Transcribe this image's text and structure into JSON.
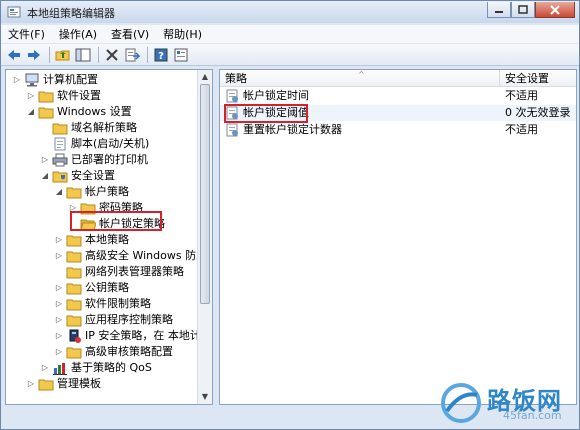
{
  "window": {
    "title": "本地组策略编辑器"
  },
  "menu": [
    {
      "label": "文件(F)"
    },
    {
      "label": "操作(A)"
    },
    {
      "label": "查看(V)"
    },
    {
      "label": "帮助(H)"
    }
  ],
  "toolbar": [
    "back-arrow-icon",
    "forward-arrow-icon",
    "up-folder-icon",
    "show-tree-icon",
    "delete-icon",
    "export-list-icon",
    "help-icon",
    "properties-icon"
  ],
  "tree": [
    {
      "label": "计算机配置",
      "depth": 0,
      "toggle": "collapsed",
      "icon": "computer"
    },
    {
      "label": "软件设置",
      "depth": 1,
      "toggle": "collapsed",
      "icon": "folder"
    },
    {
      "label": "Windows 设置",
      "depth": 1,
      "toggle": "expanded",
      "icon": "folder"
    },
    {
      "label": "域名解析策略",
      "depth": 2,
      "toggle": "none",
      "icon": "folder"
    },
    {
      "label": "脚本(启动/关机)",
      "depth": 2,
      "toggle": "none",
      "icon": "script"
    },
    {
      "label": "已部署的打印机",
      "depth": 2,
      "toggle": "collapsed",
      "icon": "printer"
    },
    {
      "label": "安全设置",
      "depth": 2,
      "toggle": "expanded",
      "icon": "security"
    },
    {
      "label": "帐户策略",
      "depth": 3,
      "toggle": "expanded",
      "icon": "folder"
    },
    {
      "label": "密码策略",
      "depth": 4,
      "toggle": "collapsed",
      "icon": "folder"
    },
    {
      "label": "帐户锁定策略",
      "depth": 4,
      "toggle": "none",
      "icon": "folder-open",
      "selected": true
    },
    {
      "label": "本地策略",
      "depth": 3,
      "toggle": "collapsed",
      "icon": "folder"
    },
    {
      "label": "高级安全 Windows 防火墙",
      "depth": 3,
      "toggle": "collapsed",
      "icon": "folder"
    },
    {
      "label": "网络列表管理器策略",
      "depth": 3,
      "toggle": "none",
      "icon": "folder"
    },
    {
      "label": "公钥策略",
      "depth": 3,
      "toggle": "collapsed",
      "icon": "folder"
    },
    {
      "label": "软件限制策略",
      "depth": 3,
      "toggle": "collapsed",
      "icon": "folder"
    },
    {
      "label": "应用程序控制策略",
      "depth": 3,
      "toggle": "collapsed",
      "icon": "folder"
    },
    {
      "label": "IP 安全策略，在 本地计算机",
      "depth": 3,
      "toggle": "collapsed",
      "icon": "ip-security"
    },
    {
      "label": "高级审核策略配置",
      "depth": 3,
      "toggle": "collapsed",
      "icon": "folder"
    },
    {
      "label": "基于策略的 QoS",
      "depth": 2,
      "toggle": "collapsed",
      "icon": "chart"
    },
    {
      "label": "管理模板",
      "depth": 1,
      "toggle": "collapsed",
      "icon": "folder"
    }
  ],
  "list": {
    "headers": [
      "策略",
      "安全设置"
    ],
    "rows": [
      {
        "policy": "帐户锁定时间",
        "setting": "不适用"
      },
      {
        "policy": "帐户锁定阈值",
        "setting": "0 次无效登录",
        "highlighted": true
      },
      {
        "policy": "重置帐户锁定计数器",
        "setting": "不适用"
      }
    ]
  },
  "watermark": {
    "brand": "路饭网",
    "domain": "45fan.com"
  },
  "colors": {
    "highlight_box": "#d4222b",
    "folder": "#f2c94c",
    "accent": "#2e86c9"
  }
}
